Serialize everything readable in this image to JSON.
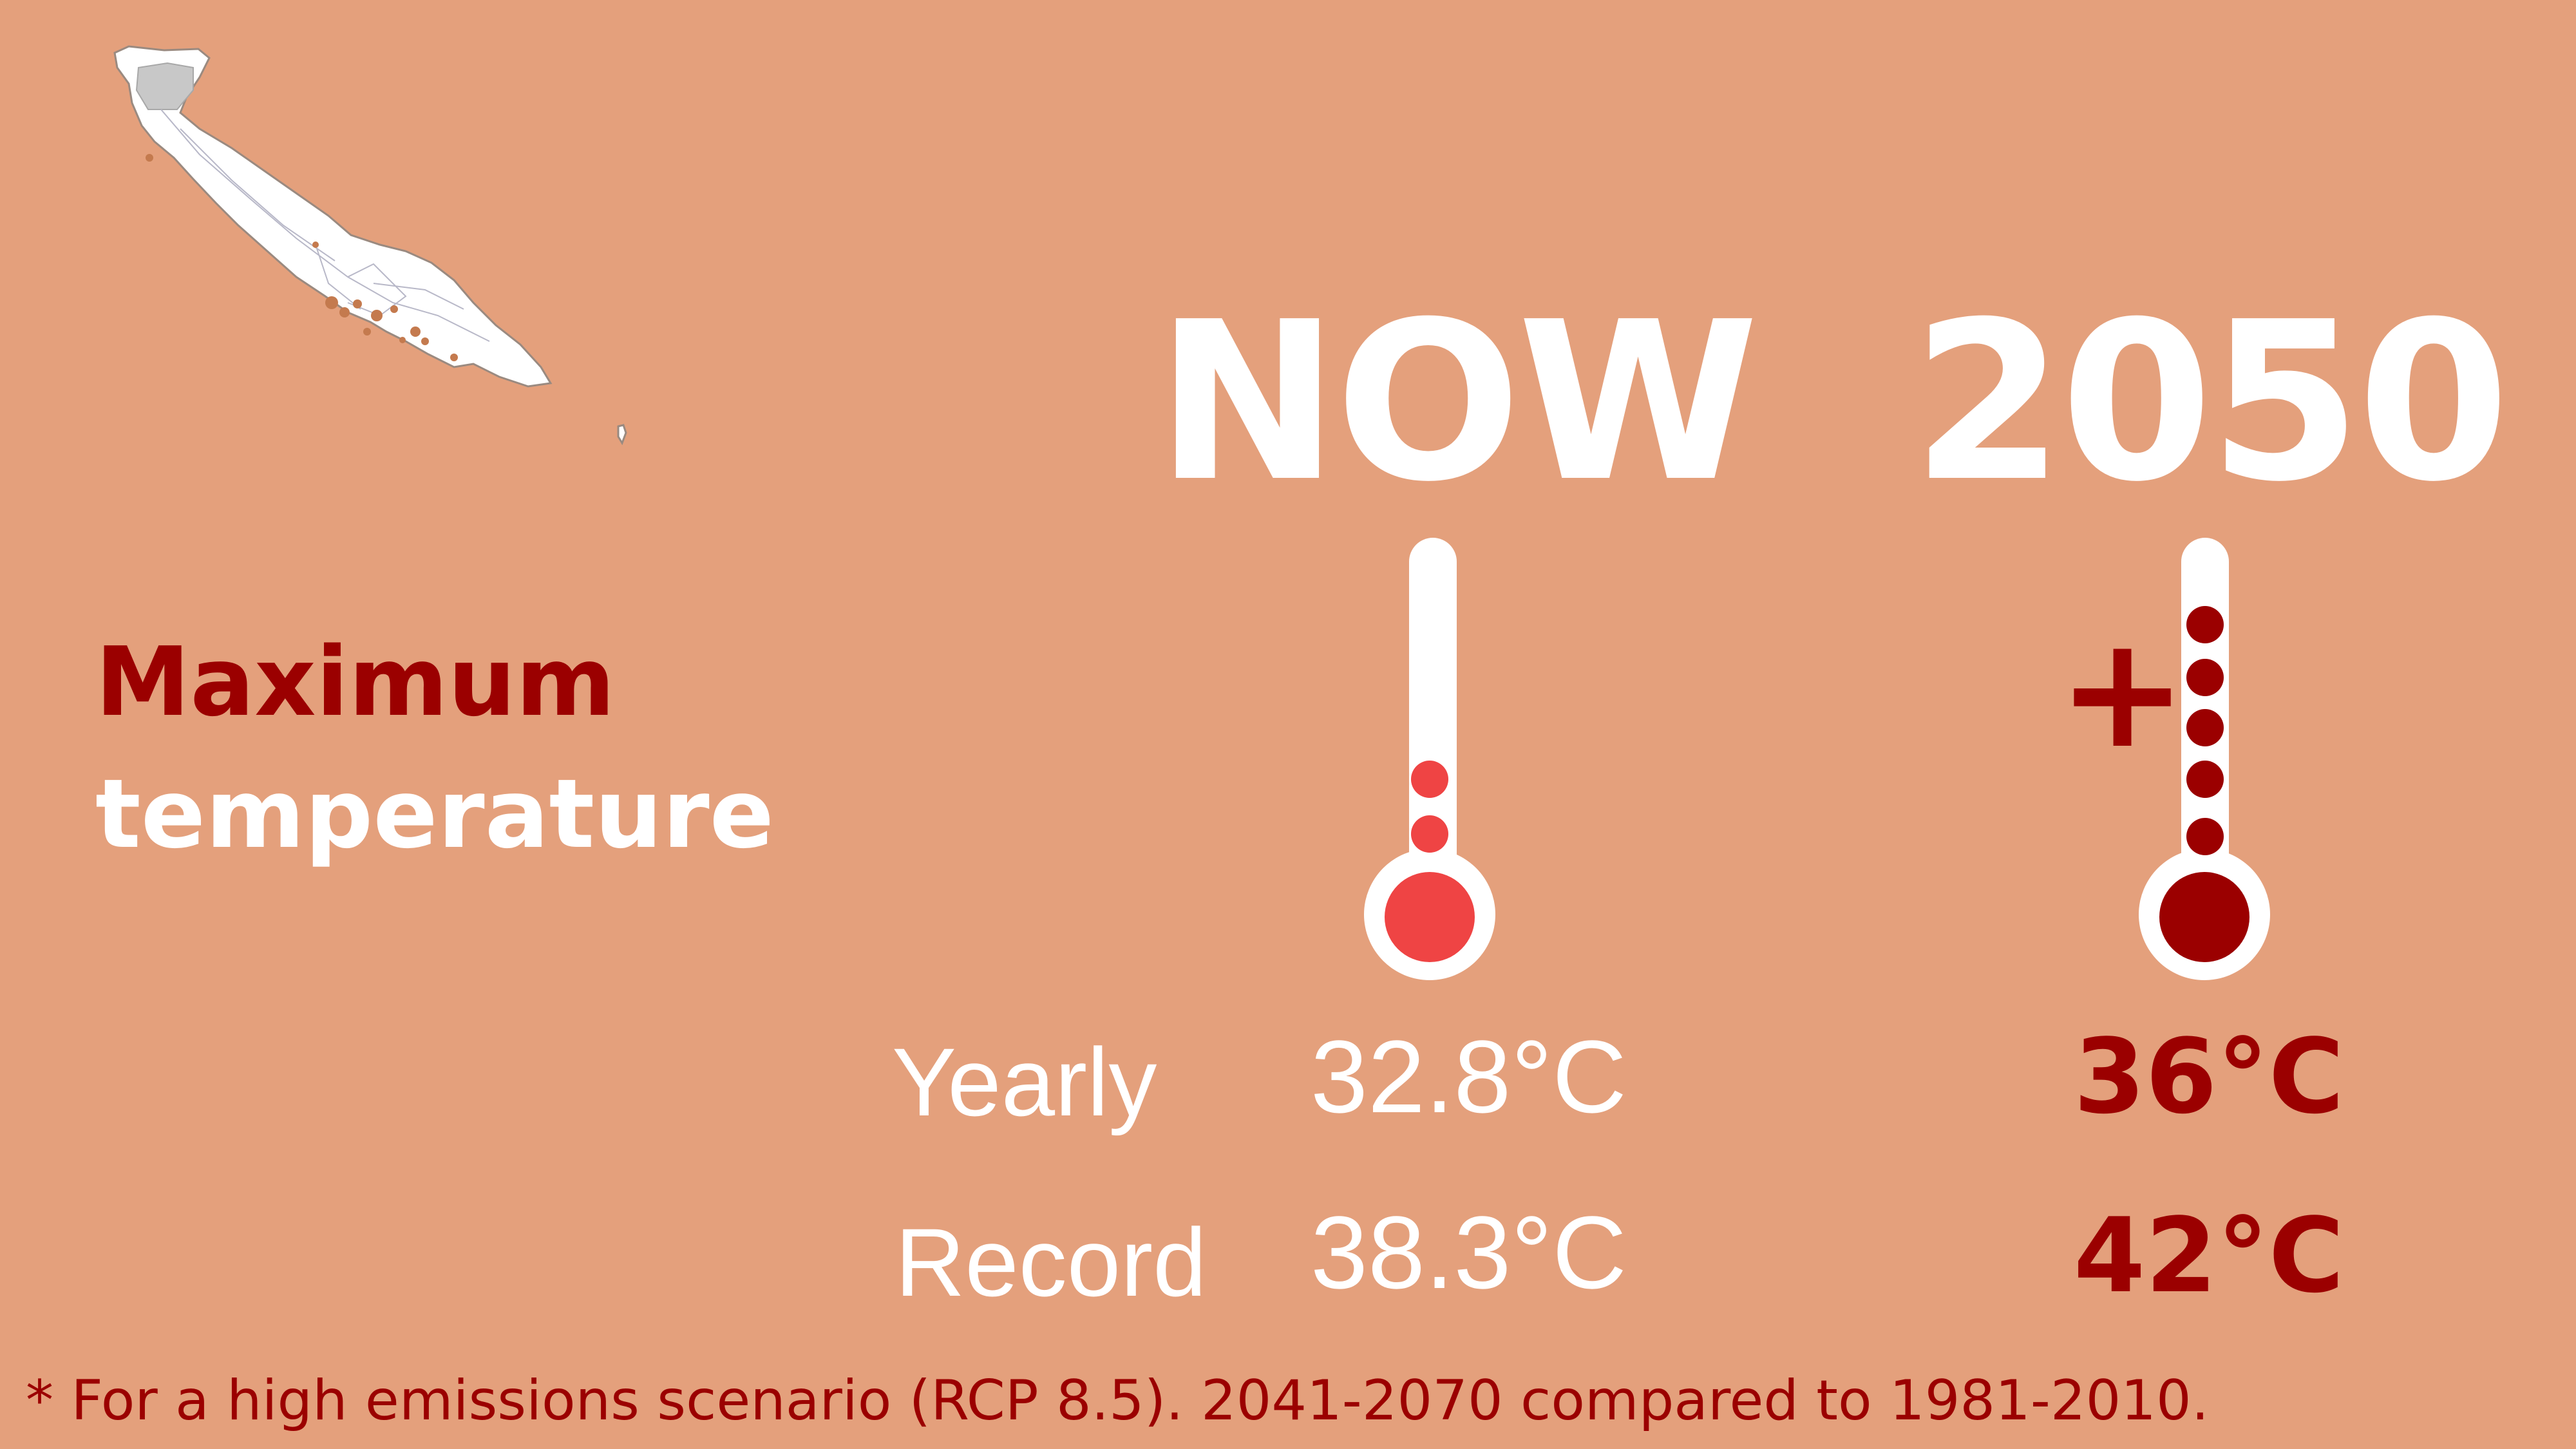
{
  "colors": {
    "background": "#E4A07C",
    "white": "#FFFFFF",
    "dark_red": "#9B0000",
    "bright_red": "#EF4444"
  },
  "title": {
    "line1": "Maximum",
    "line2": "temperature"
  },
  "columns": {
    "now": "NOW",
    "future": "2050"
  },
  "plus_sign": "+",
  "rows": [
    {
      "label": "Yearly",
      "now": "32.8°C",
      "future": "36°C"
    },
    {
      "label": "Record",
      "now": "38.3°C",
      "future": "42°C"
    }
  ],
  "thermometers": {
    "now": {
      "icon": "thermometer-icon",
      "dots": 2,
      "color": "#EF4444"
    },
    "future": {
      "icon": "thermometer-icon",
      "dots": 5,
      "color": "#9B0000"
    }
  },
  "map_icon": "curacao-island-map",
  "footnote": "* For a high emissions scenario (RCP 8.5). 2041-2070 compared to 1981-2010."
}
